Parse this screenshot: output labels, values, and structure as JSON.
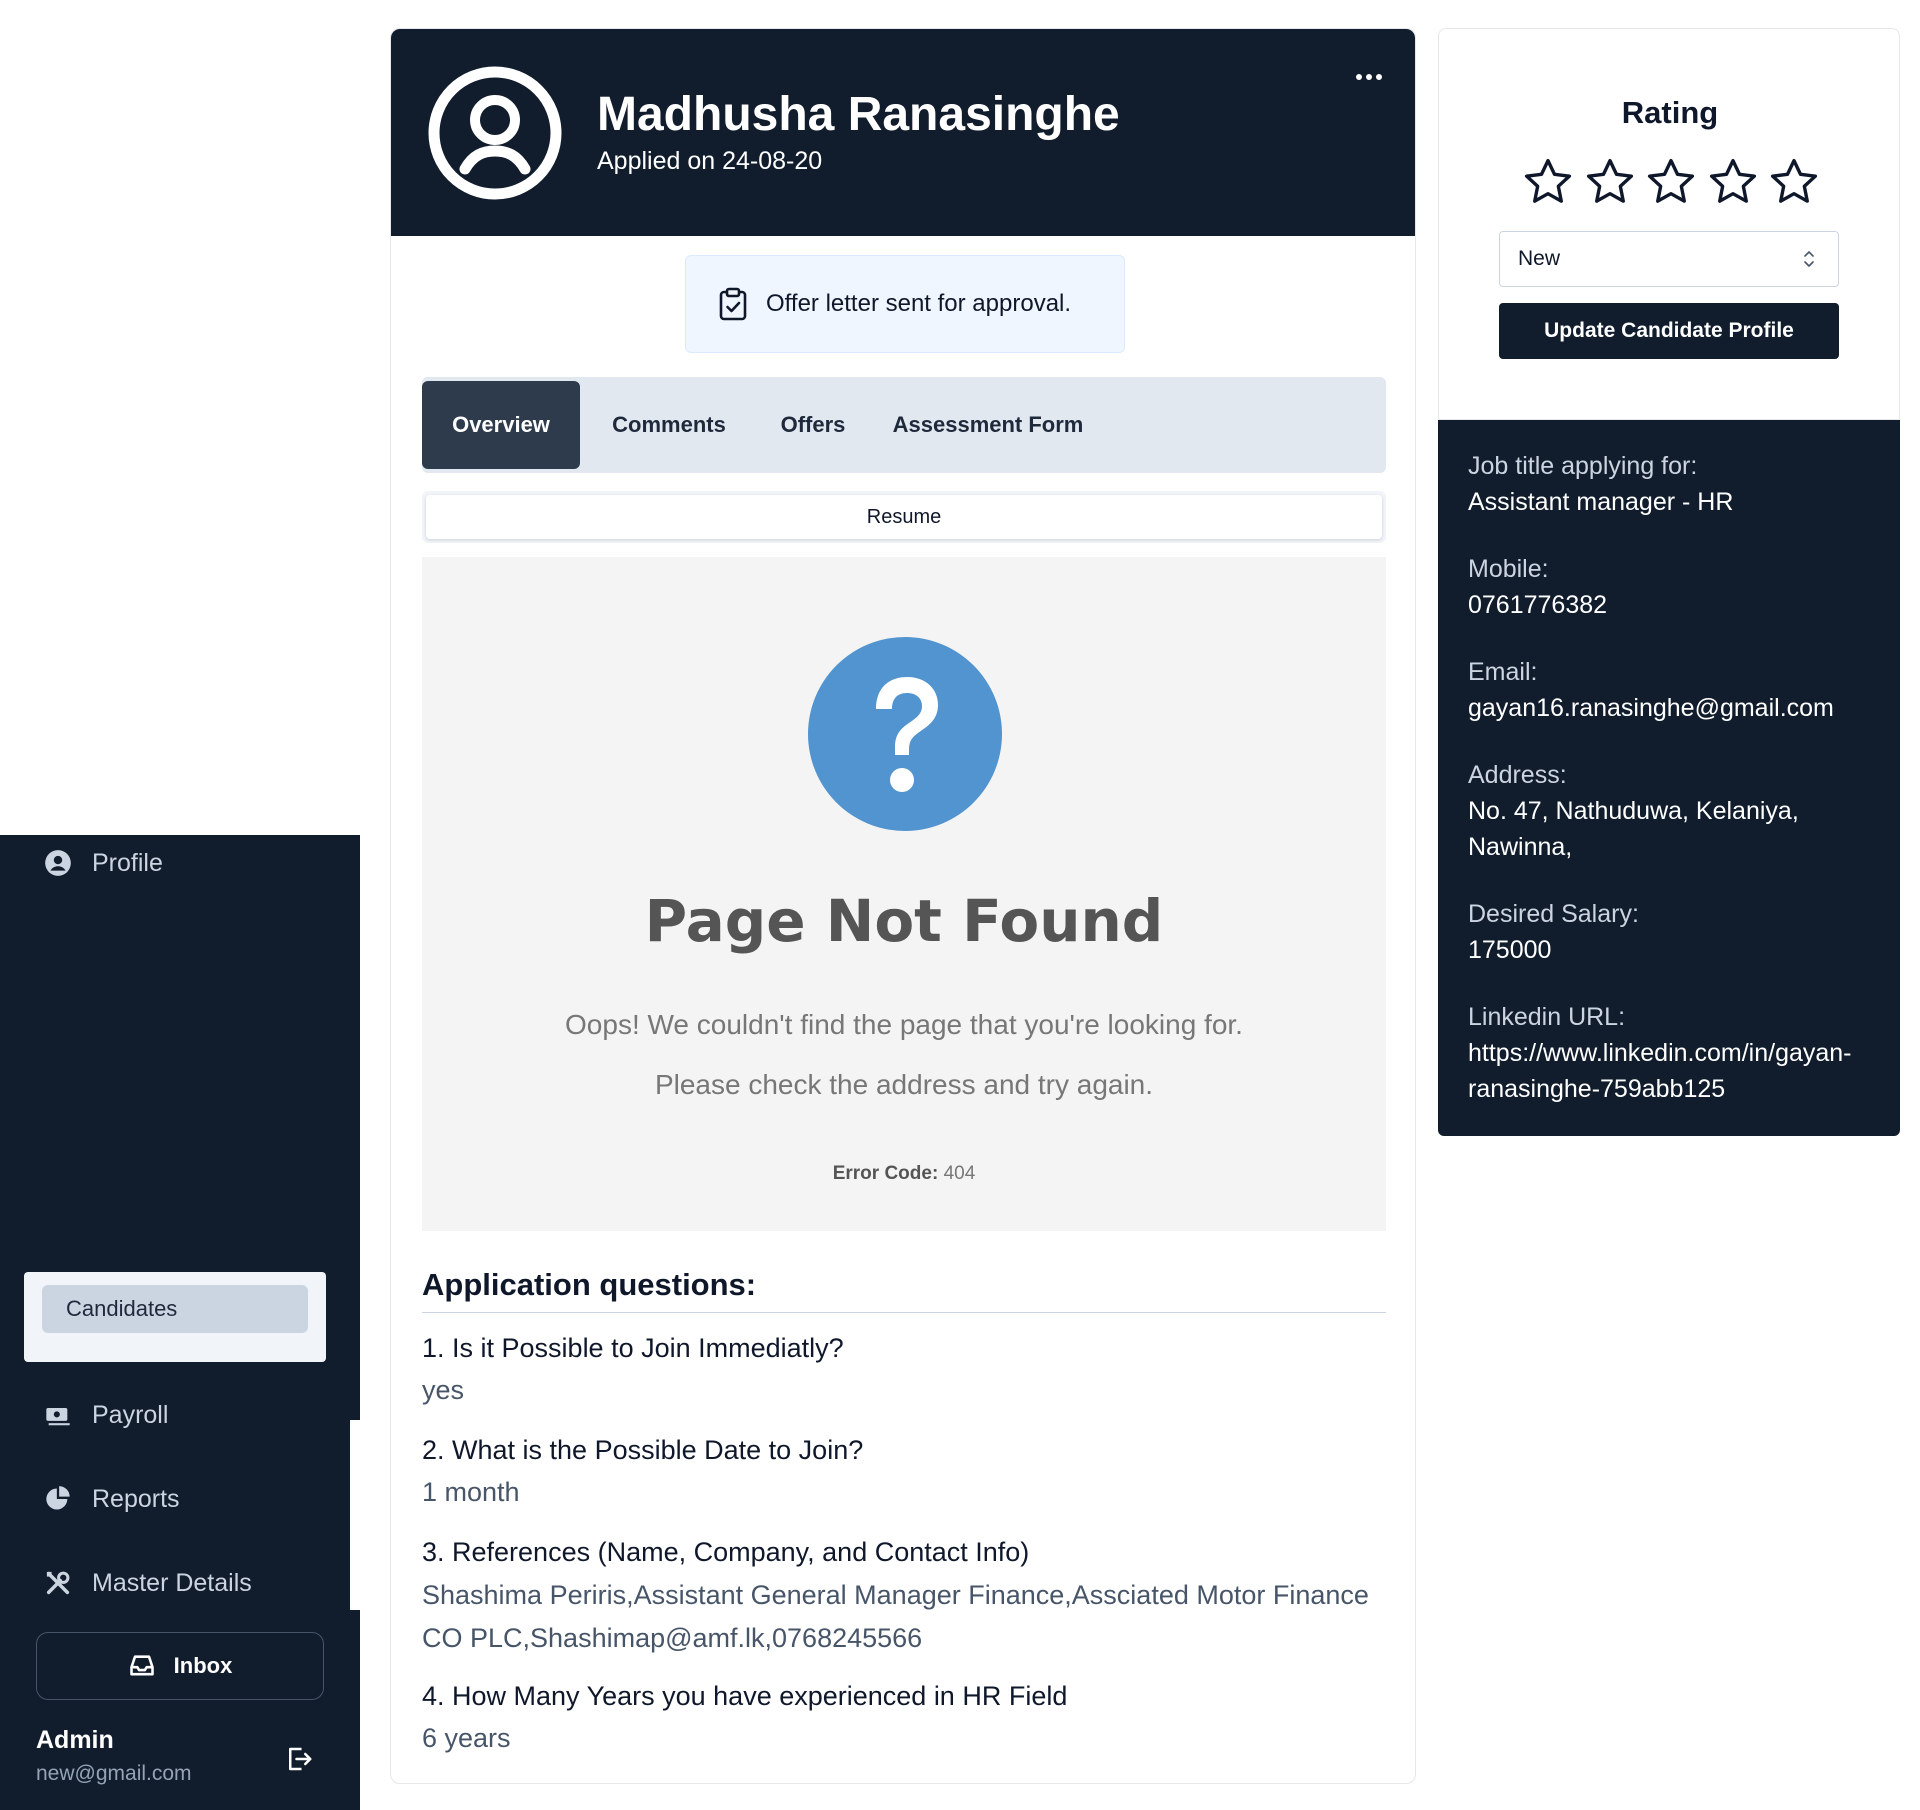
{
  "sidebar": {
    "profile_label": "Profile",
    "candidates_label": "Candidates",
    "payroll_label": "Payroll",
    "reports_label": "Reports",
    "master_details_label": "Master Details",
    "inbox_label": "Inbox",
    "user_name": "Admin",
    "user_email": "new@gmail.com"
  },
  "candidate": {
    "name": "Madhusha Ranasinghe",
    "applied": "Applied on 24-08-20"
  },
  "notice": "Offer letter sent for approval.",
  "tabs": [
    "Overview",
    "Comments",
    "Offers",
    "Assessment Form"
  ],
  "active_tab": "Overview",
  "resume_label": "Resume",
  "error_panel": {
    "title": "Page Not Found",
    "message1": "Oops! We couldn't find the page that you're looking for.",
    "message2": "Please check the address and try again.",
    "code_label": "Error Code:",
    "code_value": "404"
  },
  "application_questions": {
    "title": "Application questions:",
    "items": [
      {
        "q": "1. Is it Possible to Join Immediatly?",
        "a": "yes"
      },
      {
        "q": "2. What is the Possible Date to Join?",
        "a": "1 month"
      },
      {
        "q": "3. References (Name, Company, and Contact Info)",
        "a": "Shashima Periris,Assistant General Manager Finance,Assciated Motor Finance CO PLC,Shashimap@amf.lk,0768245566"
      },
      {
        "q": "4. How Many Years you have experienced in HR Field",
        "a": "6 years"
      }
    ]
  },
  "rating": {
    "title": "Rating",
    "value": 0,
    "max": 5,
    "status_value": "New",
    "update_label": "Update Candidate Profile"
  },
  "details": {
    "job_label": "Job title applying for:",
    "job_value": "Assistant manager - HR",
    "mobile_label": "Mobile:",
    "mobile_value": "0761776382",
    "email_label": "Email:",
    "email_value": "gayan16.ranasinghe@gmail.com",
    "address_label": "Address:",
    "address_value": "No. 47, Nathuduwa, Kelaniya, Nawinna,",
    "salary_label": "Desired Salary:",
    "salary_value": "175000",
    "linkedin_label": "Linkedin URL:",
    "linkedin_value": "https://www.linkedin.com/in/gayan-ranasinghe-759abb125"
  },
  "colors": {
    "dark_navy": "#111d2c",
    "tab_active": "#2d3b4d",
    "error_icon_blue": "#5294cf"
  },
  "icons": [
    "user-circle-icon",
    "payroll-icon",
    "reports-icon",
    "master-details-icon",
    "inbox-icon",
    "logout-icon",
    "more-horizontal-icon",
    "clipboard-check-icon",
    "question-circle-icon",
    "star-outline-icon",
    "chevron-updown-icon"
  ]
}
